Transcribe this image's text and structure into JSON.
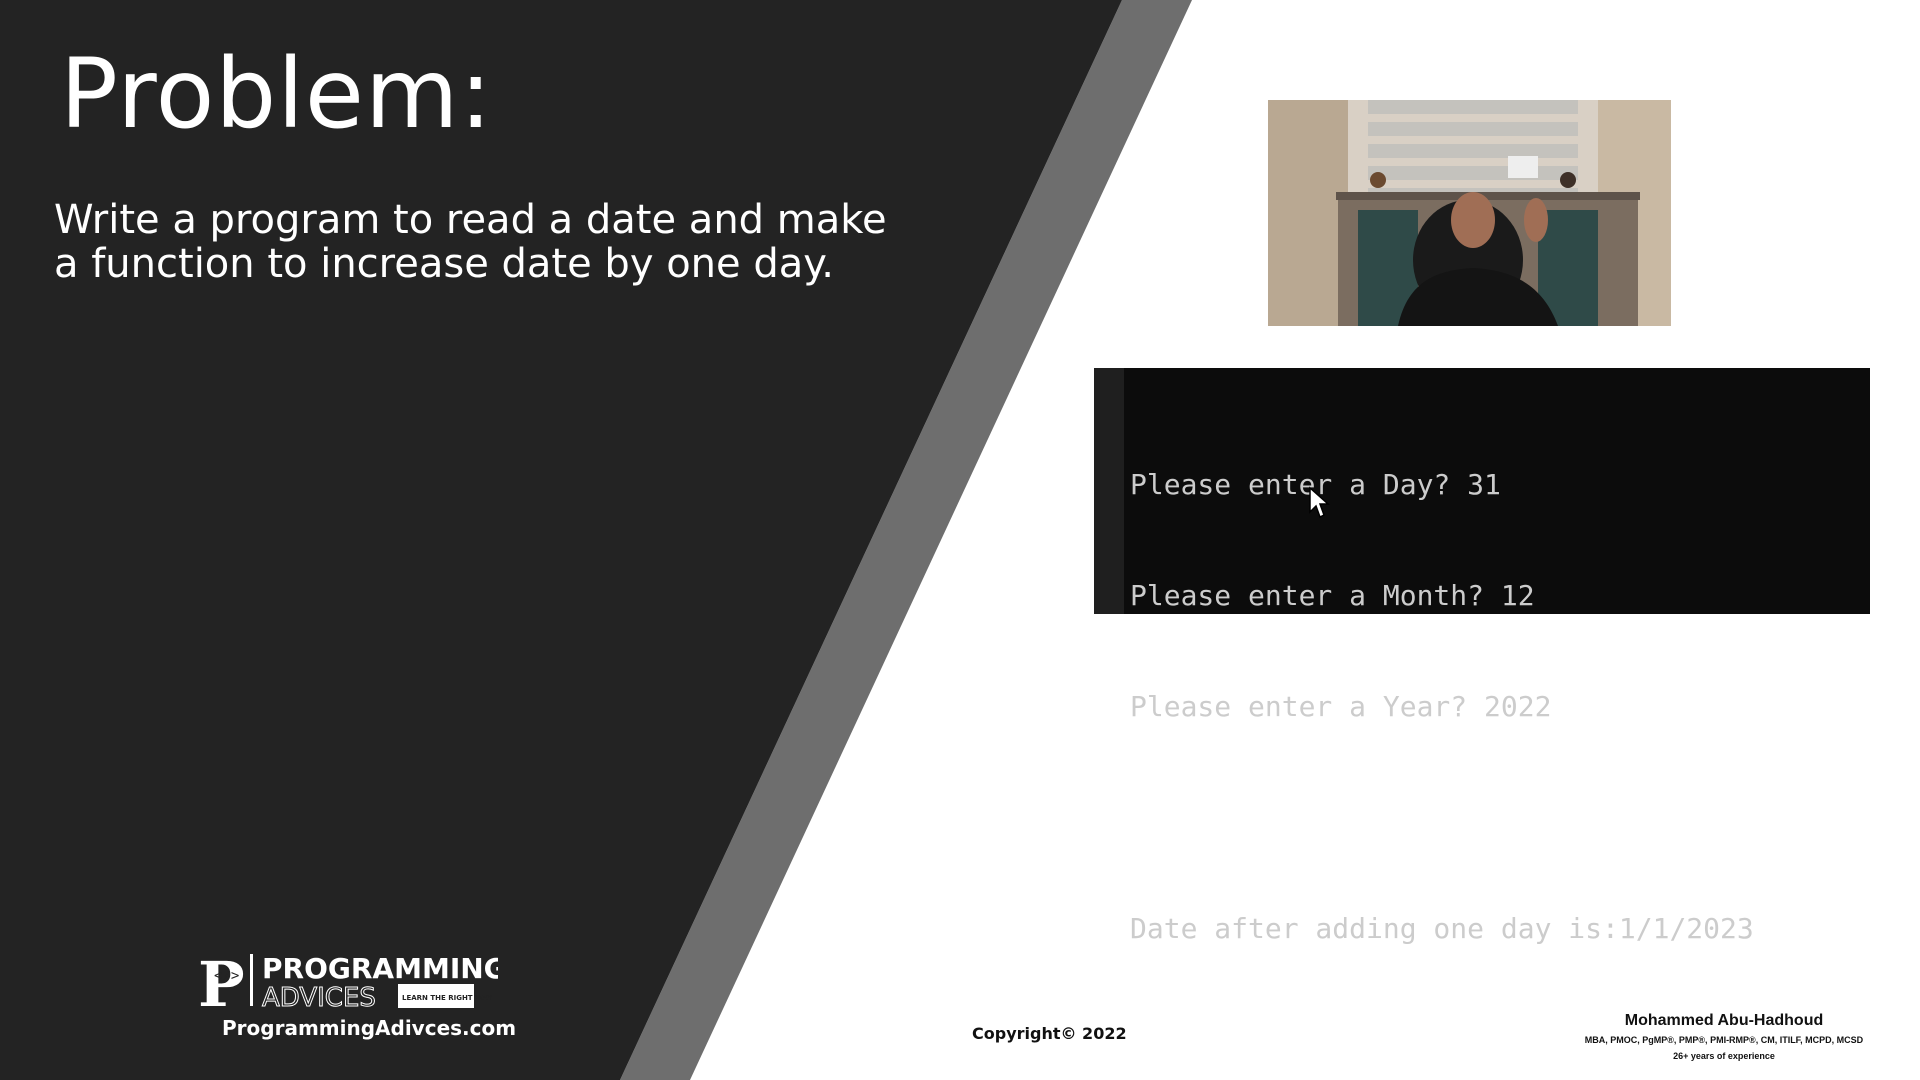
{
  "slide": {
    "title": "Problem:",
    "problem_text": "Write a program to read a date and make a function to increase date by one day."
  },
  "console": {
    "lines": [
      "Please enter a Day? 31",
      "Please enter a Month? 12",
      "Please enter a Year? 2022",
      "",
      "Date after adding one day is:1/1/2023"
    ]
  },
  "branding": {
    "logo_word1": "PROGRAMMING",
    "logo_word2": "ADVICES",
    "logo_tagline": "LEARN THE RIGHT WAY",
    "website": "ProgrammingAdivces.com"
  },
  "footer": {
    "copyright": "Copyright© 2022",
    "author_name": "Mohammed Abu-Hadhoud",
    "author_credentials": "MBA, PMOC, PgMP®, PMP®, PMI-RMP®, CM, ITILF, MCPD, MCSD",
    "author_experience": "26+ years of experience"
  },
  "colors": {
    "dark_panel": "#232323",
    "stripe": "#6e6e6e",
    "console_bg": "#0c0c0c",
    "console_text": "#cccccc"
  },
  "icons": {
    "cursor": "mouse-pointer-icon",
    "logo": "programming-advices-logo"
  }
}
